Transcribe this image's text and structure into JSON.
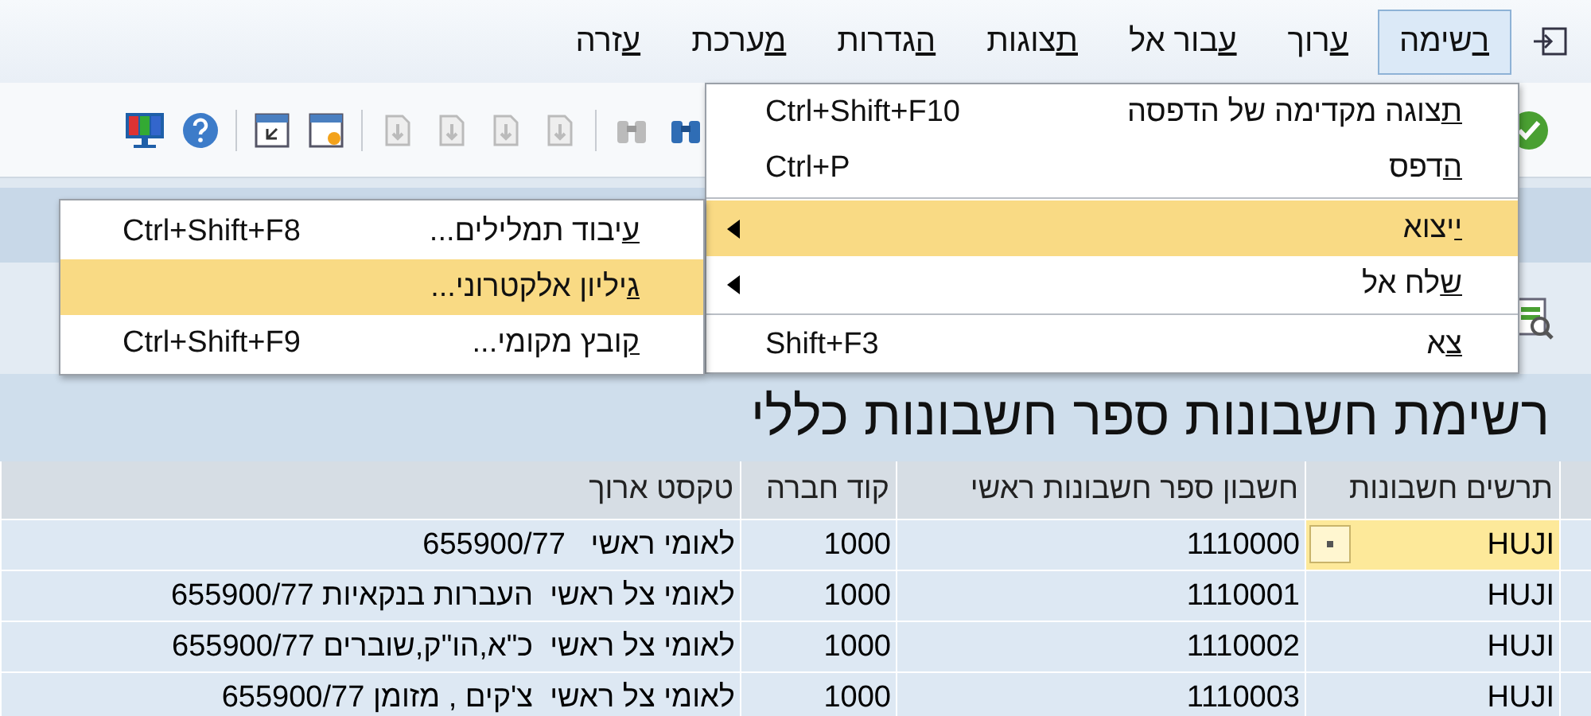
{
  "menu_bar": [
    {
      "label": "רשימה",
      "selected": true
    },
    {
      "label": "ערוך",
      "selected": false
    },
    {
      "label": "עבור אל",
      "selected": false
    },
    {
      "label": "תצוגות",
      "selected": false
    },
    {
      "label": "הגדרות",
      "selected": false
    },
    {
      "label": "מערכת",
      "selected": false
    },
    {
      "label": "עזרה",
      "selected": false
    }
  ],
  "menu": [
    {
      "kind": "command",
      "label": "תצוגה מקדימה של הדפסה",
      "shortcut": "Ctrl+Shift+F10",
      "selected": false,
      "separator_after": false
    },
    {
      "kind": "command",
      "label": "הדפס",
      "shortcut": "Ctrl+P",
      "selected": false,
      "separator_after": true
    },
    {
      "kind": "submenu",
      "label": "ייצוא",
      "selected": true,
      "separator_after": false
    },
    {
      "kind": "submenu",
      "label": "שלח אל",
      "selected": false,
      "separator_after": true
    },
    {
      "kind": "command",
      "label": "צא",
      "shortcut": "Shift+F3",
      "selected": false,
      "separator_after": false
    }
  ],
  "submenu": [
    {
      "label": "עיבוד תמלילים...",
      "shortcut": "Ctrl+Shift+F8",
      "selected": false
    },
    {
      "label": "גיליון אלקטרוני...",
      "selected": true
    },
    {
      "label": "קובץ מקומי...",
      "shortcut": "Ctrl+Shift+F9",
      "selected": false
    }
  ],
  "report_title": "רשימת חשבונות ספר חשבונות כללי",
  "table": {
    "columns": [
      "תרשים חשבונות",
      "חשבון ספר חשבונות ראשי",
      "קוד חברה",
      "טקסט ארוך"
    ],
    "rows": [
      {
        "selected": true,
        "cells": [
          "HUJI",
          "1110000",
          "1000",
          "לאומי ראשי   655900/77"
        ]
      },
      {
        "selected": false,
        "cells": [
          "HUJI",
          "1110001",
          "1000",
          "לאומי צל ראשי  העברות בנקאיות 655900/77"
        ]
      },
      {
        "selected": false,
        "cells": [
          "HUJI",
          "1110002",
          "1000",
          "לאומי צל ראשי  כ\"א,הו\"ק,שוברים 655900/77"
        ]
      },
      {
        "selected": false,
        "cells": [
          "HUJI",
          "1110003",
          "1000",
          "לאומי צל ראשי  צ'קים , מזומן 655900/77"
        ]
      }
    ]
  }
}
